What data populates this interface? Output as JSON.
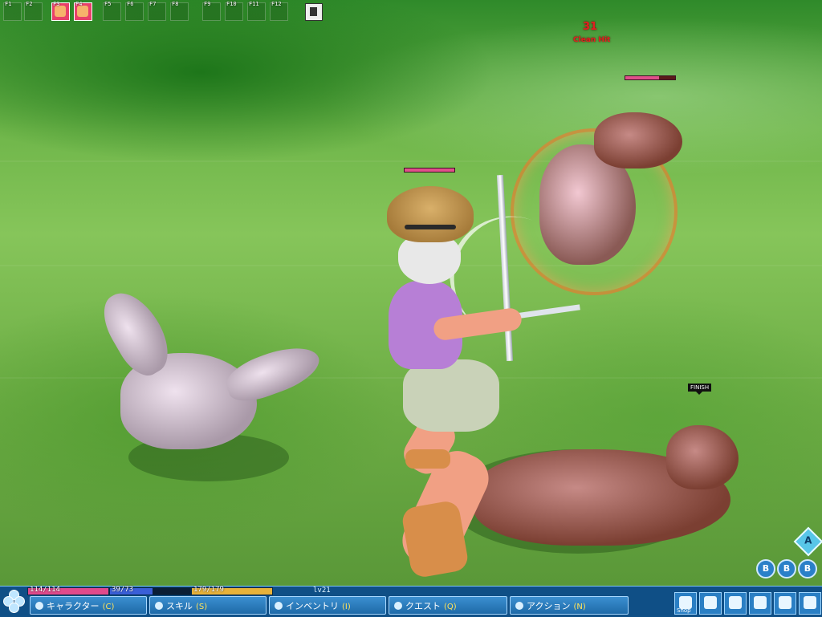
{
  "hotbar": {
    "keys": [
      "F1",
      "F2",
      "F3",
      "F4",
      "F5",
      "F6",
      "F7",
      "F8",
      "F9",
      "F10",
      "F11",
      "F12"
    ],
    "sub_keys": [
      "F1",
      "F2",
      "F3",
      "F4",
      "F5",
      "F6",
      "F7",
      "F8",
      "F9",
      "F10",
      "F11",
      "F12"
    ]
  },
  "combat": {
    "damage": "31",
    "hit_label": "Clean Hit",
    "finish_label": "FINISH"
  },
  "status": {
    "hp": "114/114",
    "mp": "39/73",
    "stamina": "179/179",
    "level_exp": "lv21 exp 0.2%",
    "hp_ratio": 1.0,
    "mp_ratio": 0.534,
    "stamina_ratio": 1.0
  },
  "menu": {
    "character": {
      "label": "キャラクター",
      "key": "(C)"
    },
    "skill": {
      "label": "スキル",
      "key": "(S)"
    },
    "inventory": {
      "label": "インベントリ",
      "key": "(I)"
    },
    "quest": {
      "label": "クエスト",
      "key": "(Q)"
    },
    "action": {
      "label": "アクション",
      "key": "(N)"
    }
  },
  "right_icons": {
    "shop_label": "Shop"
  },
  "bubbles": [
    "B",
    "B",
    "B"
  ],
  "ai_icon_label": "A",
  "colors": {
    "hp": "#e04a8c",
    "mp": "#3a5fd8",
    "stamina": "#e8b23a",
    "ui_blue": "#0f4f86"
  }
}
